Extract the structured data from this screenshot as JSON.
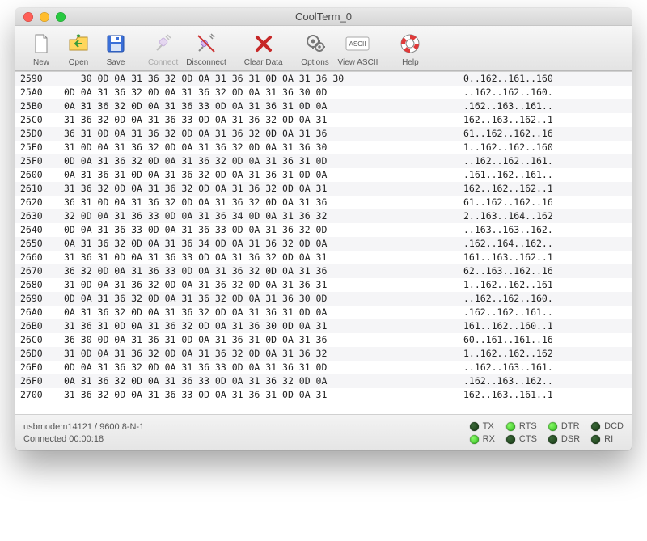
{
  "window": {
    "title": "CoolTerm_0"
  },
  "toolbar": {
    "new": "New",
    "open": "Open",
    "save": "Save",
    "connect": "Connect",
    "disconnect": "Disconnect",
    "cleardata": "Clear Data",
    "options": "Options",
    "viewascii": "View ASCII",
    "help": "Help"
  },
  "hexrows": [
    {
      "addr": "2590",
      "hex": "   30 0D 0A 31 36 32 0D 0A 31 36 31 0D 0A 31 36 30",
      "ascii": "0..162..161..160"
    },
    {
      "addr": "25A0",
      "hex": "0D 0A 31 36 32 0D 0A 31 36 32 0D 0A 31 36 30 0D",
      "ascii": "..162..162..160."
    },
    {
      "addr": "25B0",
      "hex": "0A 31 36 32 0D 0A 31 36 33 0D 0A 31 36 31 0D 0A",
      "ascii": ".162..163..161.."
    },
    {
      "addr": "25C0",
      "hex": "31 36 32 0D 0A 31 36 33 0D 0A 31 36 32 0D 0A 31",
      "ascii": "162..163..162..1"
    },
    {
      "addr": "25D0",
      "hex": "36 31 0D 0A 31 36 32 0D 0A 31 36 32 0D 0A 31 36",
      "ascii": "61..162..162..16"
    },
    {
      "addr": "25E0",
      "hex": "31 0D 0A 31 36 32 0D 0A 31 36 32 0D 0A 31 36 30",
      "ascii": "1..162..162..160"
    },
    {
      "addr": "25F0",
      "hex": "0D 0A 31 36 32 0D 0A 31 36 32 0D 0A 31 36 31 0D",
      "ascii": "..162..162..161."
    },
    {
      "addr": "2600",
      "hex": "0A 31 36 31 0D 0A 31 36 32 0D 0A 31 36 31 0D 0A",
      "ascii": ".161..162..161.."
    },
    {
      "addr": "2610",
      "hex": "31 36 32 0D 0A 31 36 32 0D 0A 31 36 32 0D 0A 31",
      "ascii": "162..162..162..1"
    },
    {
      "addr": "2620",
      "hex": "36 31 0D 0A 31 36 32 0D 0A 31 36 32 0D 0A 31 36",
      "ascii": "61..162..162..16"
    },
    {
      "addr": "2630",
      "hex": "32 0D 0A 31 36 33 0D 0A 31 36 34 0D 0A 31 36 32",
      "ascii": "2..163..164..162"
    },
    {
      "addr": "2640",
      "hex": "0D 0A 31 36 33 0D 0A 31 36 33 0D 0A 31 36 32 0D",
      "ascii": "..163..163..162."
    },
    {
      "addr": "2650",
      "hex": "0A 31 36 32 0D 0A 31 36 34 0D 0A 31 36 32 0D 0A",
      "ascii": ".162..164..162.."
    },
    {
      "addr": "2660",
      "hex": "31 36 31 0D 0A 31 36 33 0D 0A 31 36 32 0D 0A 31",
      "ascii": "161..163..162..1"
    },
    {
      "addr": "2670",
      "hex": "36 32 0D 0A 31 36 33 0D 0A 31 36 32 0D 0A 31 36",
      "ascii": "62..163..162..16"
    },
    {
      "addr": "2680",
      "hex": "31 0D 0A 31 36 32 0D 0A 31 36 32 0D 0A 31 36 31",
      "ascii": "1..162..162..161"
    },
    {
      "addr": "2690",
      "hex": "0D 0A 31 36 32 0D 0A 31 36 32 0D 0A 31 36 30 0D",
      "ascii": "..162..162..160."
    },
    {
      "addr": "26A0",
      "hex": "0A 31 36 32 0D 0A 31 36 32 0D 0A 31 36 31 0D 0A",
      "ascii": ".162..162..161.."
    },
    {
      "addr": "26B0",
      "hex": "31 36 31 0D 0A 31 36 32 0D 0A 31 36 30 0D 0A 31",
      "ascii": "161..162..160..1"
    },
    {
      "addr": "26C0",
      "hex": "36 30 0D 0A 31 36 31 0D 0A 31 36 31 0D 0A 31 36",
      "ascii": "60..161..161..16"
    },
    {
      "addr": "26D0",
      "hex": "31 0D 0A 31 36 32 0D 0A 31 36 32 0D 0A 31 36 32",
      "ascii": "1..162..162..162"
    },
    {
      "addr": "26E0",
      "hex": "0D 0A 31 36 32 0D 0A 31 36 33 0D 0A 31 36 31 0D",
      "ascii": "..162..163..161."
    },
    {
      "addr": "26F0",
      "hex": "0A 31 36 32 0D 0A 31 36 33 0D 0A 31 36 32 0D 0A",
      "ascii": ".162..163..162.."
    },
    {
      "addr": "2700",
      "hex": "31 36 32 0D 0A 31 36 33 0D 0A 31 36 31 0D 0A 31",
      "ascii": "162..163..161..1"
    }
  ],
  "status": {
    "port": "usbmodem14121 / 9600 8-N-1",
    "connection": "Connected 00:00:18",
    "leds": [
      {
        "name": "TX",
        "on": false
      },
      {
        "name": "RTS",
        "on": true
      },
      {
        "name": "DTR",
        "on": true
      },
      {
        "name": "DCD",
        "on": false
      },
      {
        "name": "RX",
        "on": true
      },
      {
        "name": "CTS",
        "on": false
      },
      {
        "name": "DSR",
        "on": false
      },
      {
        "name": "RI",
        "on": false
      }
    ]
  }
}
